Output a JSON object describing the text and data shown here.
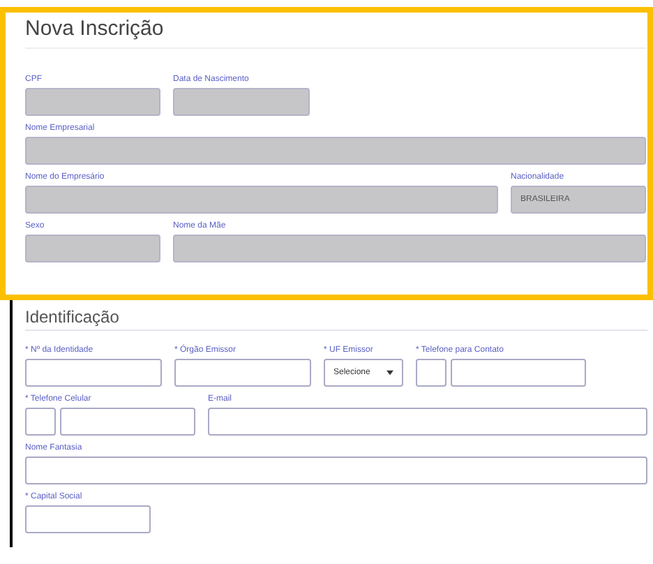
{
  "sections": [
    {
      "title": "Nova Inscrição",
      "highlighted": true,
      "rows": [
        {
          "fields": [
            {
              "kind": "text",
              "label": "CPF",
              "disabled": true
            },
            {
              "kind": "text",
              "label": "Data de Nascimento",
              "disabled": true
            }
          ]
        },
        {
          "fields": [
            {
              "kind": "text",
              "label": "Nome Empresarial",
              "disabled": true
            }
          ]
        },
        {
          "fields": [
            {
              "kind": "text",
              "label": "Nome do Empresário",
              "disabled": true
            },
            {
              "kind": "text",
              "label": "Nacionalidade",
              "disabled": true,
              "value": "BRASILEIRA"
            }
          ]
        },
        {
          "fields": [
            {
              "kind": "text",
              "label": "Sexo",
              "disabled": true
            },
            {
              "kind": "text",
              "label": "Nome da Mãe",
              "disabled": true
            }
          ]
        }
      ]
    },
    {
      "title": "Identificação",
      "highlighted": false,
      "rows": [
        {
          "fields": [
            {
              "kind": "text",
              "label": "* Nº da Identidade",
              "disabled": false
            },
            {
              "kind": "text",
              "label": "* Órgão Emissor",
              "disabled": false
            },
            {
              "kind": "select",
              "label": "* UF Emissor",
              "disabled": false,
              "value": "Selecione"
            },
            {
              "kind": "phone",
              "label": "* Telefone para Contato",
              "disabled": false
            }
          ]
        },
        {
          "fields": [
            {
              "kind": "phone",
              "label": "* Telefone Celular",
              "disabled": false
            },
            {
              "kind": "text",
              "label": "E-mail",
              "disabled": false
            }
          ]
        },
        {
          "fields": [
            {
              "kind": "text",
              "label": "Nome Fantasia",
              "disabled": false
            }
          ]
        },
        {
          "fields": [
            {
              "kind": "text",
              "label": "* Capital Social",
              "disabled": false
            }
          ]
        }
      ]
    }
  ]
}
